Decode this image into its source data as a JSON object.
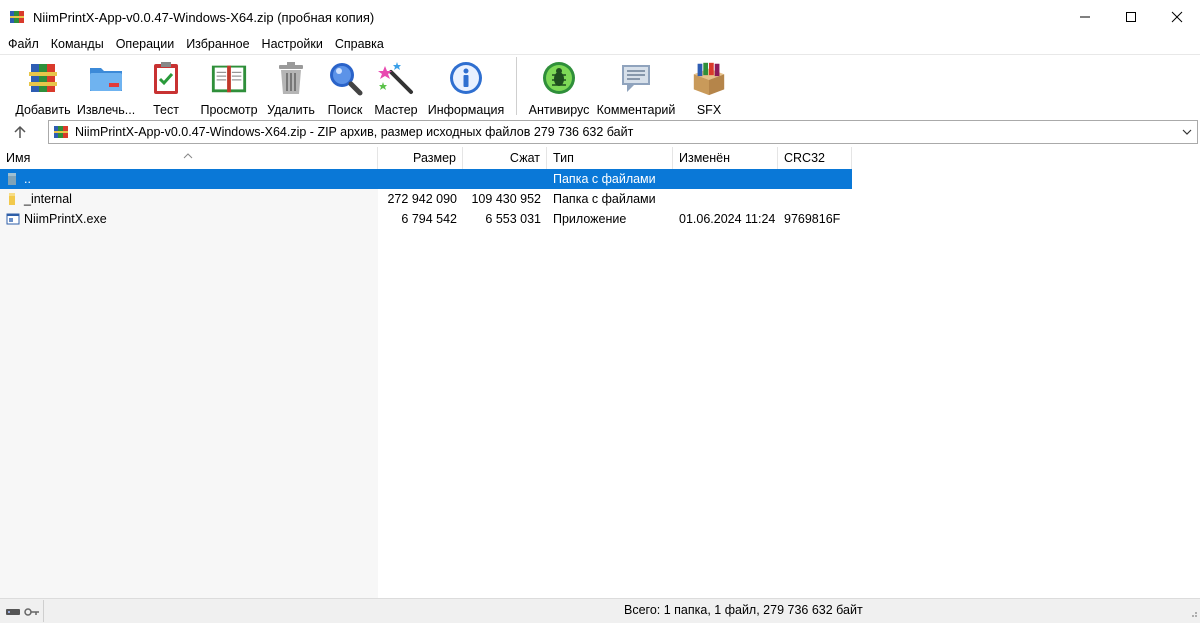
{
  "window": {
    "title": "NiimPrintX-App-v0.0.47-Windows-X64.zip (пробная копия)"
  },
  "menu": [
    "Файл",
    "Команды",
    "Операции",
    "Избранное",
    "Настройки",
    "Справка"
  ],
  "toolbar": {
    "add": "Добавить",
    "extract": "Извлечь...",
    "test": "Тест",
    "view": "Просмотр",
    "delete": "Удалить",
    "find": "Поиск",
    "wizard": "Мастер",
    "info": "Информация",
    "virus": "Антивирус",
    "comment": "Комментарий",
    "sfx": "SFX"
  },
  "address": {
    "text": "NiimPrintX-App-v0.0.47-Windows-X64.zip - ZIP архив, размер исходных файлов 279 736 632 байт"
  },
  "columns": {
    "name": "Имя",
    "size": "Размер",
    "packed": "Сжат",
    "type": "Тип",
    "modified": "Изменён",
    "crc": "CRC32"
  },
  "rows": [
    {
      "name": "..",
      "size": "",
      "packed": "",
      "type": "Папка с файлами",
      "modified": "",
      "crc": "",
      "icon": "parent-folder-icon"
    },
    {
      "name": "_internal",
      "size": "272 942 090",
      "packed": "109 430 952",
      "type": "Папка с файлами",
      "modified": "",
      "crc": "",
      "icon": "folder-icon"
    },
    {
      "name": "NiimPrintX.exe",
      "size": "6 794 542",
      "packed": "6 553 031",
      "type": "Приложение",
      "modified": "01.06.2024 11:24",
      "crc": "9769816F",
      "icon": "exe-file-icon"
    }
  ],
  "status": {
    "text": "Всего: 1 папка, 1 файл, 279 736 632 байт"
  },
  "colors": {
    "selection": "#0a78d7"
  }
}
